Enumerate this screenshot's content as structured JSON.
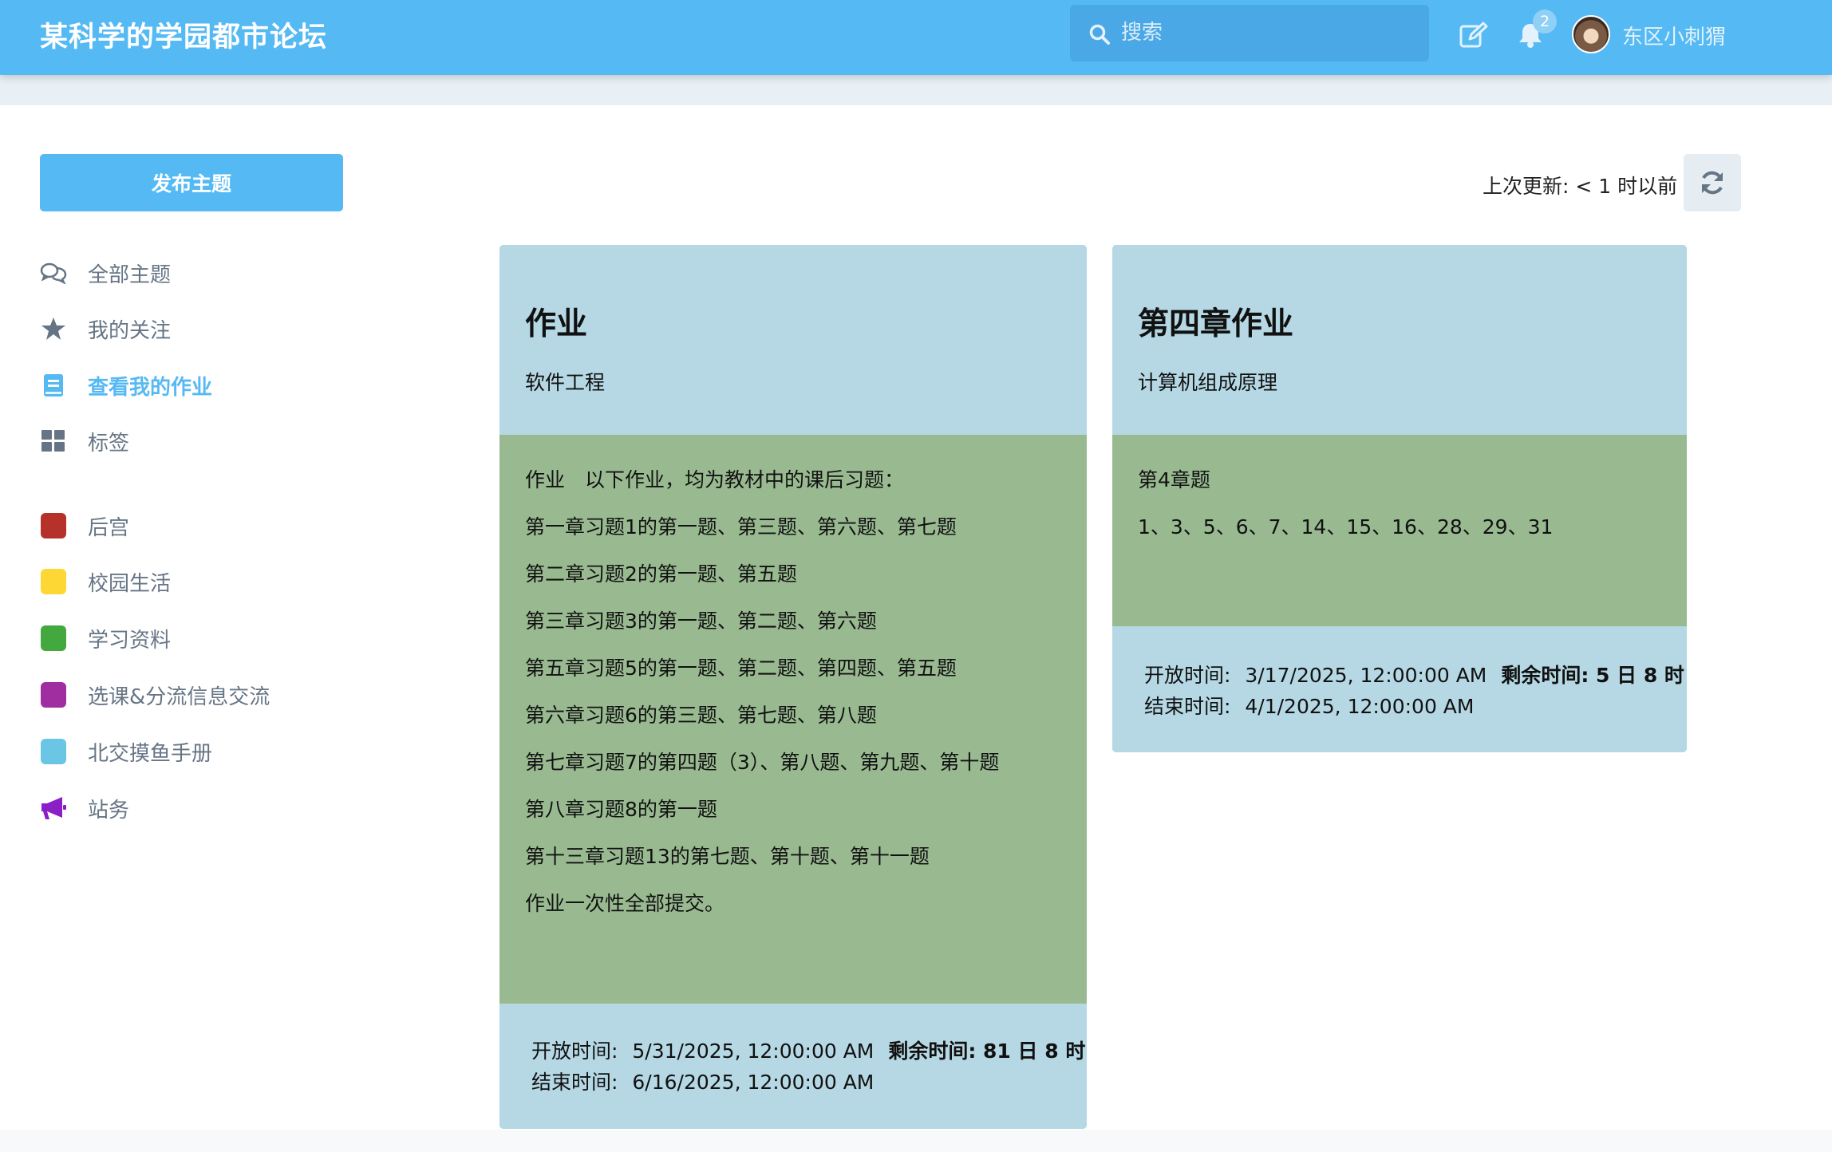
{
  "header": {
    "site_title": "某科学的学园都市论坛",
    "search_placeholder": "搜索",
    "notification_count": "2",
    "username": "东区小刺猬"
  },
  "sidebar": {
    "publish_label": "发布主题",
    "nav": [
      {
        "label": "全部主题",
        "icon": "comments-icon"
      },
      {
        "label": "我的关注",
        "icon": "star-icon"
      },
      {
        "label": "查看我的作业",
        "icon": "book-icon",
        "active": true
      },
      {
        "label": "标签",
        "icon": "grid-icon"
      }
    ],
    "tags": [
      {
        "label": "后宫",
        "color": "#b7312b"
      },
      {
        "label": "校园生活",
        "color": "#fdd835"
      },
      {
        "label": "学习资料",
        "color": "#43a83e"
      },
      {
        "label": "选课&分流信息交流",
        "color": "#a12ea1"
      },
      {
        "label": "北交摸鱼手册",
        "color": "#6ac6e4"
      },
      {
        "label": "站务",
        "icon": "megaphone-icon",
        "color": "#8a1fc8"
      }
    ]
  },
  "toolbar": {
    "last_update": "上次更新: < 1 时以前"
  },
  "cards": [
    {
      "title": "作业",
      "course": "软件工程",
      "body": [
        "作业　以下作业，均为教材中的课后习题：",
        "第一章习题1的第一题、第三题、第六题、第七题",
        "第二章习题2的第一题、第五题",
        "第三章习题3的第一题、第二题、第六题",
        "第五章习题5的第一题、第二题、第四题、第五题",
        "第六章习题6的第三题、第七题、第八题",
        "第七章习题7的第四题（3）、第八题、第九题、第十题",
        "第八章习题8的第一题",
        "第十三章习题13的第七题、第十题、第十一题",
        "作业一次性全部提交。"
      ],
      "open_label": "开放时间:",
      "open_time": "5/31/2025, 12:00:00 AM",
      "remaining": "剩余时间: 81 日 8 时",
      "end_label": "结束时间:",
      "end_time": "6/16/2025, 12:00:00 AM"
    },
    {
      "title": "第四章作业",
      "course": "计算机组成原理",
      "body": [
        "第4章题",
        "1、3、5、6、7、14、15、16、28、29、31"
      ],
      "open_label": "开放时间:",
      "open_time": "3/17/2025, 12:00:00 AM",
      "remaining": "剩余时间: 5 日 8 时",
      "end_label": "结束时间:",
      "end_time": "4/1/2025, 12:00:00 AM"
    }
  ]
}
